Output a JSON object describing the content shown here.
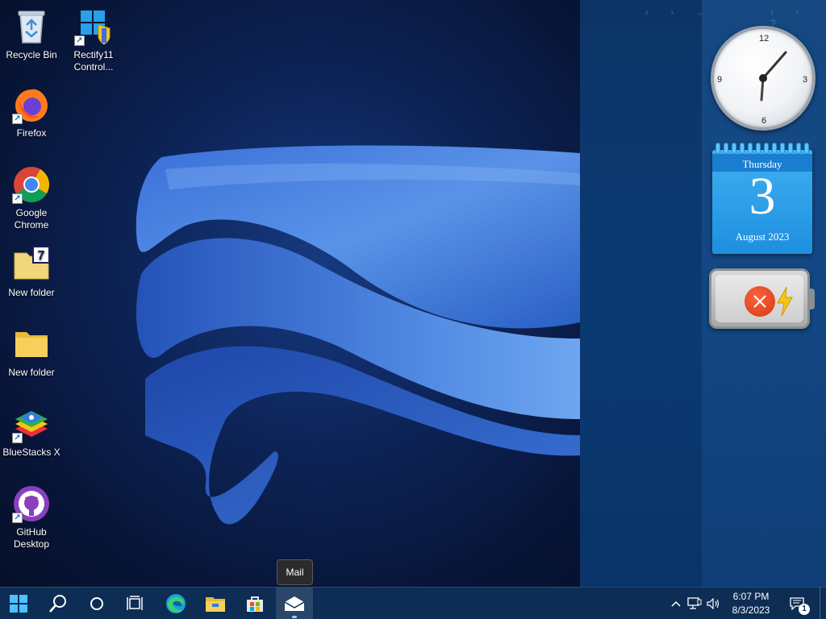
{
  "desktop": {
    "icons": [
      {
        "label": "Recycle Bin",
        "icon": "recycle-bin-icon"
      },
      {
        "label": "Rectify11 Control...",
        "icon": "windows-control-panel-icon"
      },
      {
        "label": "Firefox",
        "icon": "firefox-icon"
      },
      {
        "label": "Google Chrome",
        "icon": "chrome-icon"
      },
      {
        "label": "New folder",
        "icon": "archive-folder-icon"
      },
      {
        "label": "New folder",
        "icon": "folder-icon"
      },
      {
        "label": "BlueStacks X",
        "icon": "bluestacks-icon"
      },
      {
        "label": "GitHub Desktop",
        "icon": "github-icon"
      }
    ]
  },
  "gadgets": {
    "clock": {
      "numerals": [
        "12",
        "3",
        "6",
        "9"
      ],
      "time": "6:07"
    },
    "calendar": {
      "weekday": "Thursday",
      "day": "3",
      "month_year": "August 2023"
    },
    "battery": {
      "status_icon": "error-icon",
      "charging_icon": "lightning-icon"
    }
  },
  "tooltip": {
    "text": "Mail"
  },
  "taskbar": {
    "buttons": [
      {
        "name": "start-button",
        "icon": "windows-logo-icon"
      },
      {
        "name": "search-button",
        "icon": "search-icon"
      },
      {
        "name": "cortana-button",
        "icon": "circle-icon"
      },
      {
        "name": "task-view-button",
        "icon": "task-view-icon"
      },
      {
        "name": "edge-button",
        "icon": "edge-icon"
      },
      {
        "name": "file-explorer-button",
        "icon": "folder-icon"
      },
      {
        "name": "store-button",
        "icon": "store-icon"
      },
      {
        "name": "mail-button",
        "icon": "mail-icon"
      }
    ],
    "tray": {
      "time": "6:07 PM",
      "date": "8/3/2023",
      "notification_count": "1"
    }
  },
  "colors": {
    "taskbar": "#0d2d54",
    "calendar": "#1e8fe0",
    "battery_error": "#d8380f"
  }
}
